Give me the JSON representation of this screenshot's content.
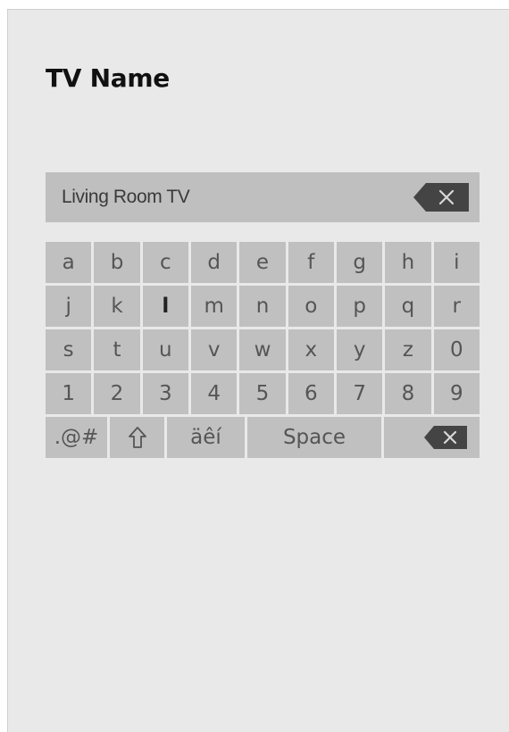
{
  "page": {
    "title": "TV Name"
  },
  "name_field": {
    "value": "Living Room TV",
    "clear_icon": "backspace-x-icon"
  },
  "keyboard": {
    "rows": [
      [
        "a",
        "b",
        "c",
        "d",
        "e",
        "f",
        "g",
        "h",
        "i"
      ],
      [
        "j",
        "k",
        "l",
        "m",
        "n",
        "o",
        "p",
        "q",
        "r"
      ],
      [
        "s",
        "t",
        "u",
        "v",
        "w",
        "x",
        "y",
        "z",
        "0"
      ],
      [
        "1",
        "2",
        "3",
        "4",
        "5",
        "6",
        "7",
        "8",
        "9"
      ]
    ],
    "bottom_row": {
      "symbols_label": ".@#",
      "shift_icon": "shift-arrow-icon",
      "accents_label": "äêí",
      "space_label": "Space",
      "backspace_icon": "backspace-x-icon"
    }
  },
  "colors": {
    "background": "#e9e9e9",
    "key": "#c0c0c0",
    "field": "#bfbfbf",
    "key_text": "#555555",
    "icon_dark": "#444444"
  }
}
